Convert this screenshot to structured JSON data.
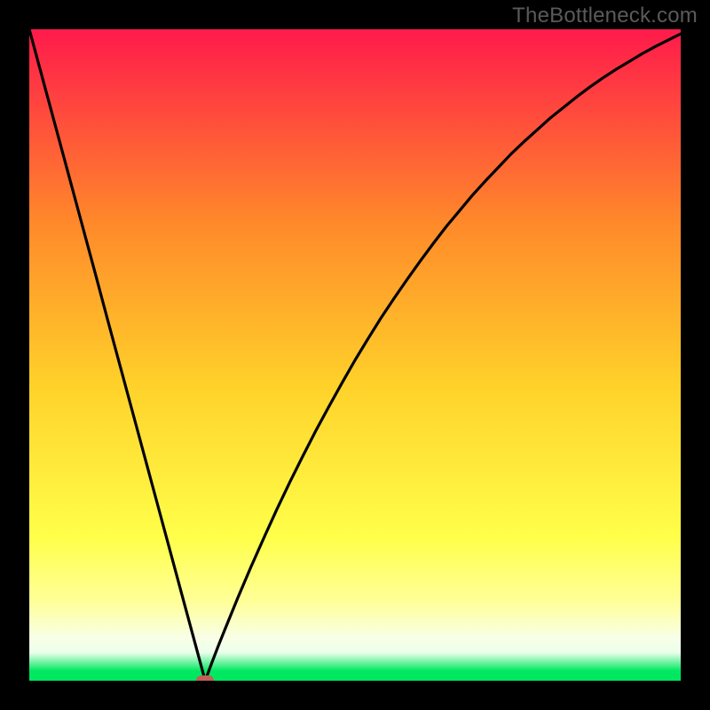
{
  "watermark": "TheBottleneck.com",
  "colors": {
    "top": "#ff1a4b",
    "mid_upper": "#ff8a2a",
    "mid": "#ffd22a",
    "lower_yellow": "#ffff4a",
    "pale_yellow": "#ffff9a",
    "off_white": "#f8ffe8",
    "near_white": "#eaffea",
    "green": "#00e860",
    "black": "#000000",
    "marker": "#c06058"
  },
  "chart_data": {
    "type": "line",
    "title": "",
    "xlabel": "",
    "ylabel": "",
    "xlim": [
      0,
      100
    ],
    "ylim": [
      0,
      100
    ],
    "x": [
      0,
      2,
      4,
      6,
      8,
      10,
      12,
      14,
      16,
      18,
      20,
      22,
      24,
      26,
      27,
      28,
      29,
      30,
      32,
      34,
      36,
      38,
      40,
      42,
      44,
      46,
      48,
      50,
      52,
      54,
      56,
      58,
      60,
      62,
      64,
      66,
      68,
      70,
      72,
      74,
      76,
      78,
      80,
      82,
      84,
      86,
      88,
      90,
      92,
      94,
      96,
      98,
      100
    ],
    "y": [
      100,
      92.6,
      85.2,
      77.8,
      70.4,
      63.0,
      55.5,
      48.1,
      40.7,
      33.3,
      25.9,
      18.5,
      11.1,
      3.7,
      0.0,
      2.7,
      5.3,
      7.8,
      12.7,
      17.4,
      21.9,
      26.3,
      30.5,
      34.5,
      38.4,
      42.1,
      45.7,
      49.2,
      52.5,
      55.7,
      58.7,
      61.6,
      64.4,
      67.1,
      69.7,
      72.1,
      74.5,
      76.7,
      78.8,
      80.9,
      82.8,
      84.6,
      86.4,
      88.0,
      89.6,
      91.1,
      92.5,
      93.8,
      95.0,
      96.2,
      97.3,
      98.3,
      99.3
    ],
    "gradient_stops": [
      {
        "pos": 0.0,
        "color_key": "top"
      },
      {
        "pos": 0.3,
        "color_key": "mid_upper"
      },
      {
        "pos": 0.55,
        "color_key": "mid"
      },
      {
        "pos": 0.78,
        "color_key": "lower_yellow"
      },
      {
        "pos": 0.88,
        "color_key": "pale_yellow"
      },
      {
        "pos": 0.935,
        "color_key": "off_white"
      },
      {
        "pos": 0.957,
        "color_key": "near_white"
      },
      {
        "pos": 0.985,
        "color_key": "green"
      },
      {
        "pos": 1.0,
        "color_key": "green"
      }
    ],
    "marker": {
      "x": 27,
      "y": 0
    }
  }
}
